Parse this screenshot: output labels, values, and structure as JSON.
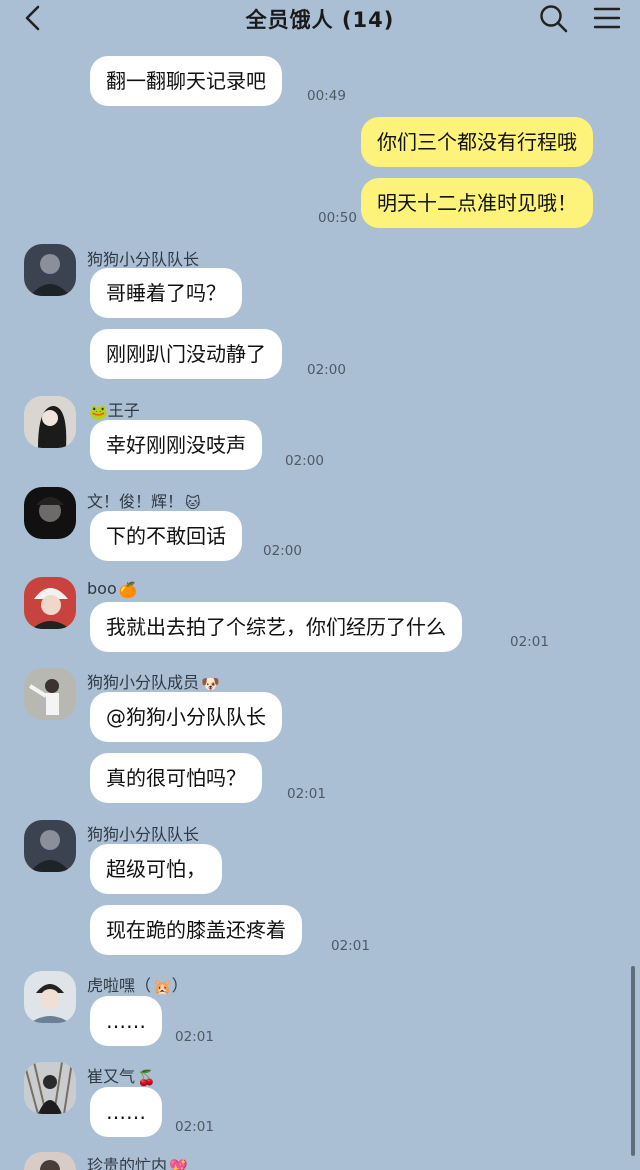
{
  "header": {
    "title": "全员饿人 (14)"
  },
  "messages": [
    {
      "text": "翻一翻聊天记录吧",
      "time": "00:49"
    },
    {
      "text": "你们三个都没有行程哦"
    },
    {
      "text": "明天十二点准时见哦！",
      "time": "00:50"
    },
    {
      "sender": "狗狗小分队队长",
      "text": "哥睡着了吗？"
    },
    {
      "text": "刚刚趴门没动静了",
      "time": "02:00"
    },
    {
      "sender": "王子",
      "text": "幸好刚刚没吱声",
      "time": "02:00"
    },
    {
      "sender": "文！俊！辉！",
      "text": "下的不敢回话",
      "time": "02:00"
    },
    {
      "sender": "boo",
      "text": "我就出去拍了个综艺，你们经历了什么",
      "time": "02:01"
    },
    {
      "sender": "狗狗小分队成员",
      "text": "@狗狗小分队队长"
    },
    {
      "text": "真的很可怕吗？",
      "time": "02:01"
    },
    {
      "sender": "狗狗小分队队长",
      "text": "超级可怕，"
    },
    {
      "text": "现在跪的膝盖还疼着",
      "time": "02:01"
    },
    {
      "sender": "虎啦嘿（",
      "sender_suffix": "）",
      "text": "……",
      "time": "02:01"
    },
    {
      "sender": "崔又气",
      "text": "……",
      "time": "02:01"
    },
    {
      "sender": "珍贵的忙内"
    }
  ],
  "emojis": {
    "frog": "🐸",
    "cat": "🐱",
    "orange": "🍊",
    "dog": "🐶",
    "hamster": "🐹",
    "cherry": "🍒",
    "heart": "💖"
  },
  "colors": {
    "background": "#abbfd4",
    "incoming_bubble": "#ffffff",
    "outgoing_bubble": "#fef37a"
  }
}
